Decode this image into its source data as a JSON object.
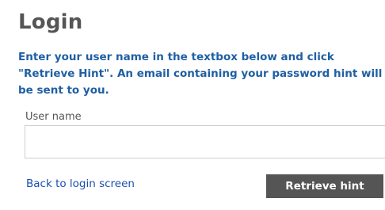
{
  "page": {
    "title": "Login",
    "instructions": "Enter your user name in the textbox below and click \"Retrieve Hint\". An email containing your password hint will be sent to you."
  },
  "form": {
    "username_label": "User name",
    "username_value": "",
    "username_placeholder": ""
  },
  "actions": {
    "back_link": "Back to login screen",
    "retrieve_button": "Retrieve hint"
  },
  "colors": {
    "title": "#555555",
    "instructions": "#1f5fa3",
    "link": "#1a4fb0",
    "button_background": "#555555",
    "button_text": "#ffffff"
  }
}
